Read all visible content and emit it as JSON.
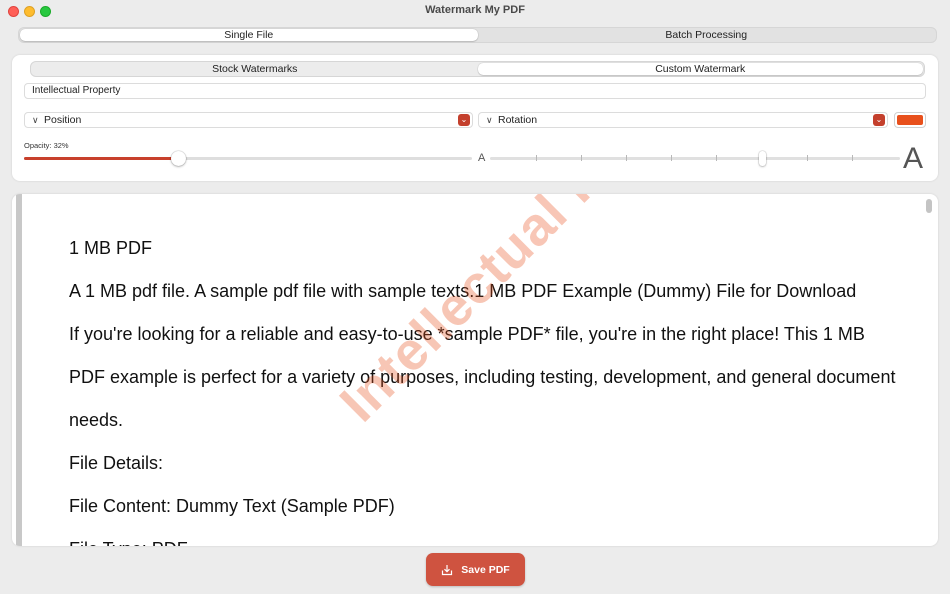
{
  "window": {
    "title": "Watermark My PDF"
  },
  "mode_tabs": [
    {
      "label": "Single File",
      "selected": true
    },
    {
      "label": "Batch Processing",
      "selected": false
    }
  ],
  "watermark_tabs": [
    {
      "label": "Stock Watermarks",
      "selected": false
    },
    {
      "label": "Custom Watermark",
      "selected": true
    }
  ],
  "watermark_text": "Intellectual Property",
  "position_select": {
    "label": "Position"
  },
  "rotation_select": {
    "label": "Rotation"
  },
  "color": {
    "watermark": "#e8501c",
    "accent": "#cf5340"
  },
  "opacity": {
    "label": "Opacity: 32%",
    "value": 0.32
  },
  "size_slider": {
    "min_label": "A",
    "max_label": "A",
    "value": 0.67
  },
  "document": {
    "paragraphs": [
      "1 MB PDF",
      "A 1 MB pdf file. A sample pdf file with sample texts.1 MB PDF Example (Dummy) File for Download",
      "If you're looking for a reliable and easy-to-use *sample PDF* file, you're in the right place! This 1 MB PDF example is perfect for a variety of purposes, including testing, development, and general document needs.",
      "File Details:",
      "File Content: Dummy Text (Sample PDF)",
      "File Type: PDF"
    ],
    "watermark_overlay": "Intellectual Property"
  },
  "save_button": {
    "label": "Save PDF",
    "icon": "save-download-icon"
  }
}
